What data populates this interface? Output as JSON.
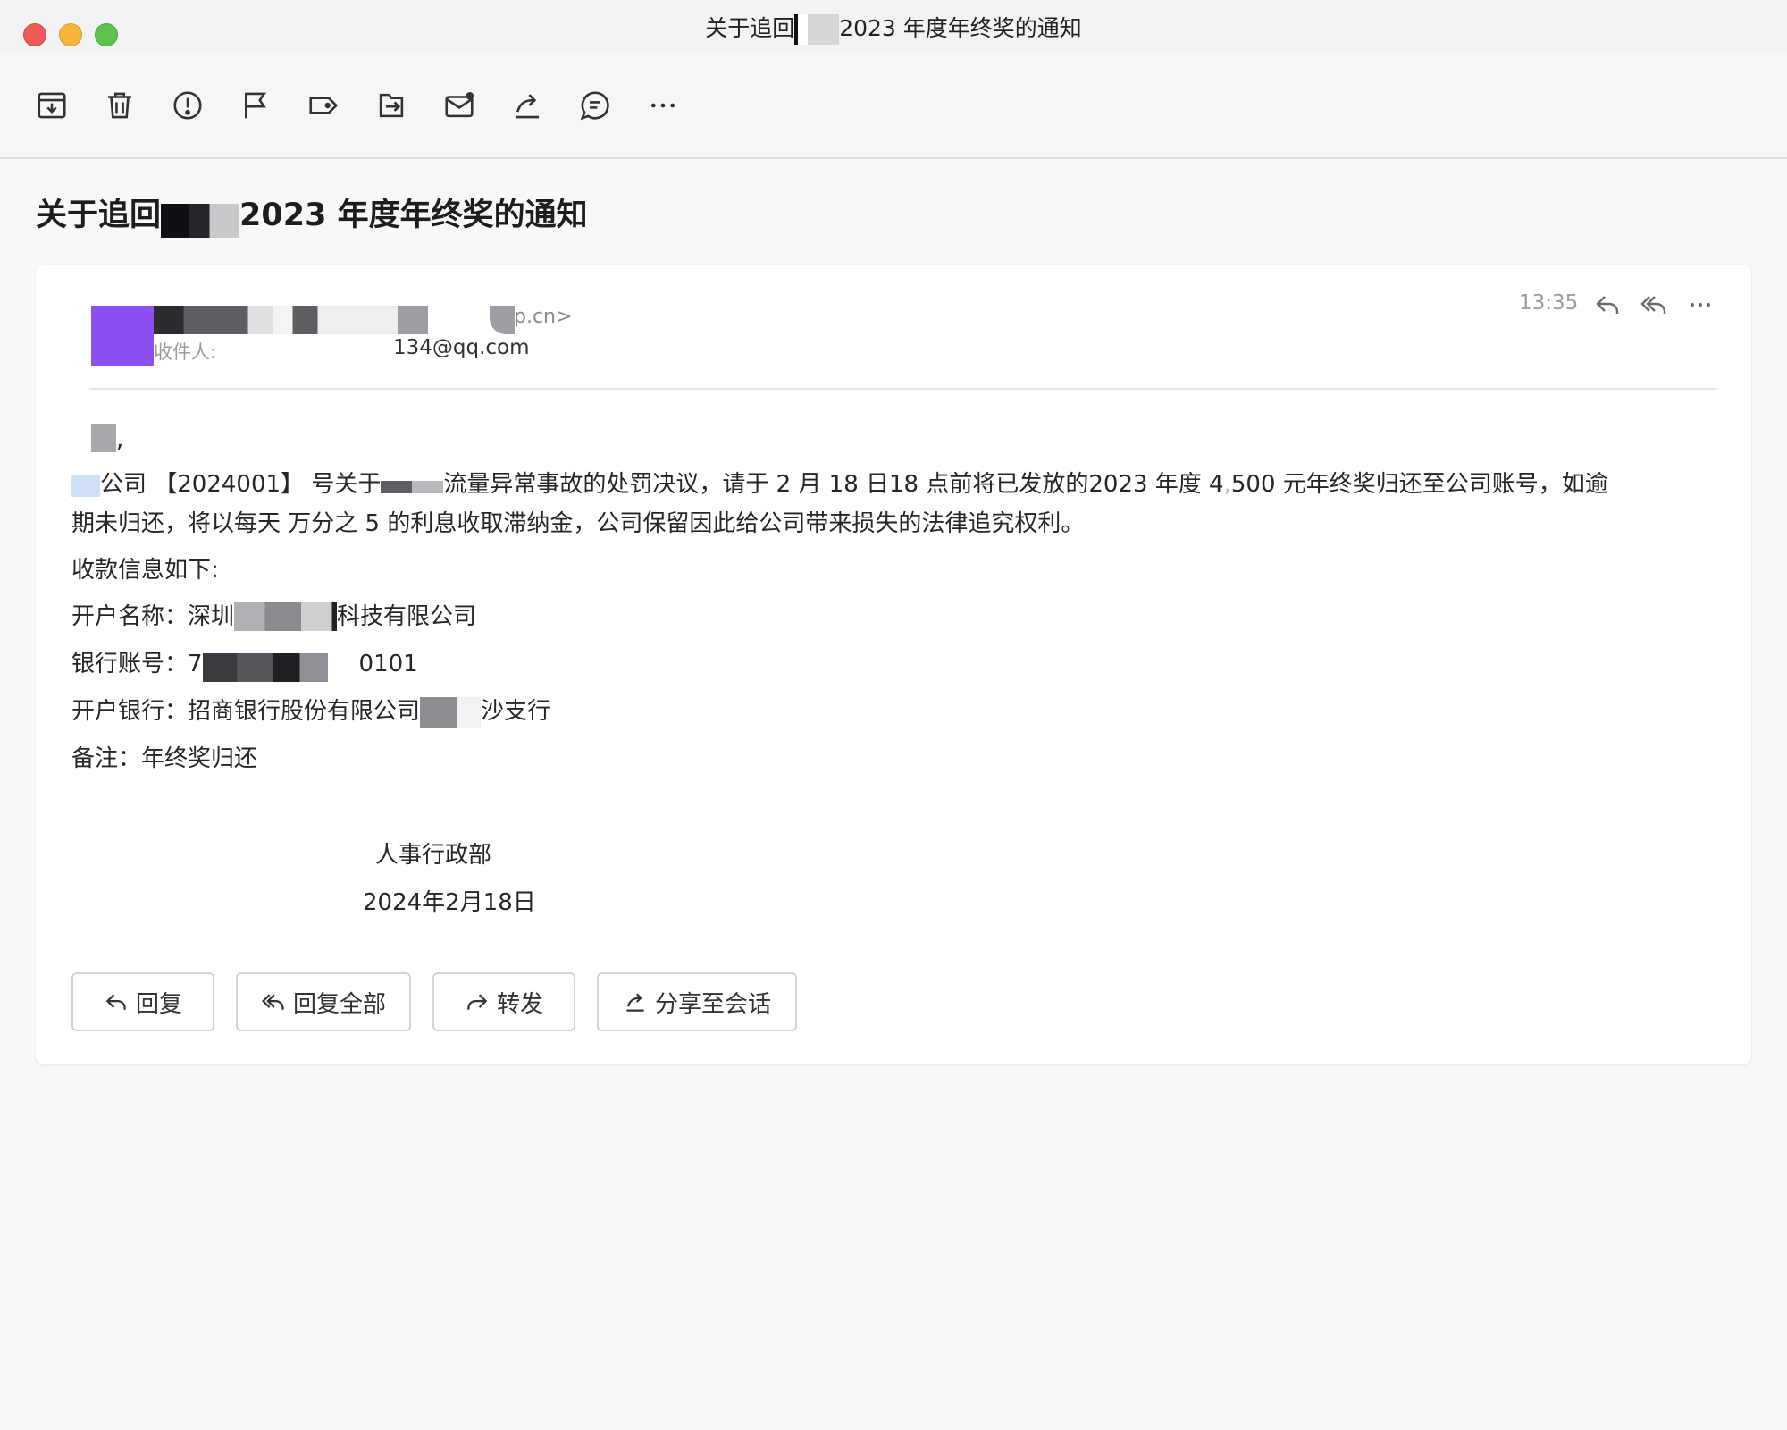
{
  "window": {
    "title_prefix": "关于追回",
    "title_suffix": "2023 年度年终奖的通知"
  },
  "toolbar": {
    "buttons": [
      {
        "icon": "archive-icon"
      },
      {
        "icon": "trash-icon"
      },
      {
        "icon": "spam-icon"
      },
      {
        "icon": "flag-icon"
      },
      {
        "icon": "tag-icon"
      },
      {
        "icon": "move-icon"
      },
      {
        "icon": "mark-unread-icon"
      },
      {
        "icon": "forward-icon"
      },
      {
        "icon": "comment-icon"
      },
      {
        "icon": "more-icon"
      }
    ]
  },
  "email": {
    "subject_prefix": "关于追回",
    "subject_suffix": "2023 年度年终奖的通知",
    "sender_email_tail": "p.cn>",
    "recipient_label": "收件人:",
    "recipient_value": "134@qq.com",
    "time": "13:35",
    "greeting": ",",
    "body_line1_a": "公司 【2024001】 号关于",
    "body_line1_b": "流量异常事故的处罚决议，请于 2 月 18 日18 点前将已发放的2023 年度 4",
    "body_line1_c": "500 元年终奖归还至公司账号，如逾",
    "body_line2": "期未归还，将以每天 万分之 5 的利息收取滞纳金，公司保留因此给公司带来损失的法律追究权利。",
    "payment_intro": "收款信息如下:",
    "account_name_label": "开户名称：深圳",
    "account_name_tail": "科技有限公司",
    "account_number_label": "银行账号：7",
    "account_number_tail": "0101",
    "bank_label": "开户银行：招商银行股份有限公司",
    "bank_tail": "沙支行",
    "note": "备注：年终奖归还",
    "signature_dept": "人事行政部",
    "signature_date": "2024年2月18日"
  },
  "actions": {
    "reply": "回复",
    "reply_all": "回复全部",
    "forward": "转发",
    "share": "分享至会话"
  }
}
